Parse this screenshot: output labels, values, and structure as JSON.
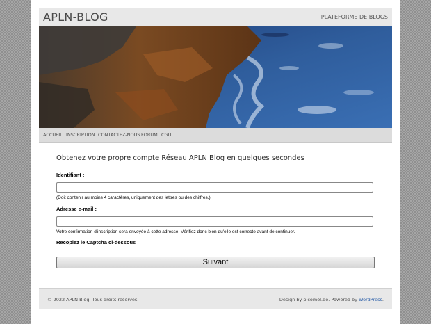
{
  "header": {
    "site_title": "APLN-BLOG",
    "tagline": "PLATEFORME DE BLOGS"
  },
  "nav": {
    "items": [
      {
        "label": "ACCUEIL"
      },
      {
        "label": "INSCRIPTION"
      },
      {
        "label": "CONTACTEZ-NOUS"
      },
      {
        "label": "FORUM"
      },
      {
        "label": "CGU"
      }
    ]
  },
  "form": {
    "heading": "Obtenez votre propre compte Réseau APLN Blog en quelques secondes",
    "username_label": "Identifiant :",
    "username_value": "",
    "username_hint": "(Doit contenir au moins 4 caractères, uniquement des lettres ou des chiffres.)",
    "email_label": "Adresse e-mail :",
    "email_value": "",
    "email_hint": "Votre confirmation d'inscription sera envoyée à cette adresse. Vérifiez donc bien qu'elle est correcte avant de continuer.",
    "captcha_label": "Recopiez le Captcha ci-dessous",
    "submit_label": "Suivant"
  },
  "footer": {
    "copyright": "© 2022 APLN-Blog. Tous droits réservés.",
    "credits_prefix": "Design by picomol.de. Powered by ",
    "credits_link": "WordPress",
    "credits_suffix": "."
  },
  "colors": {
    "background_pattern": "#8f8f8f",
    "header_bg": "#e8e8e8",
    "nav_bg": "#dcdcdc",
    "link": "#2a5ea8"
  }
}
